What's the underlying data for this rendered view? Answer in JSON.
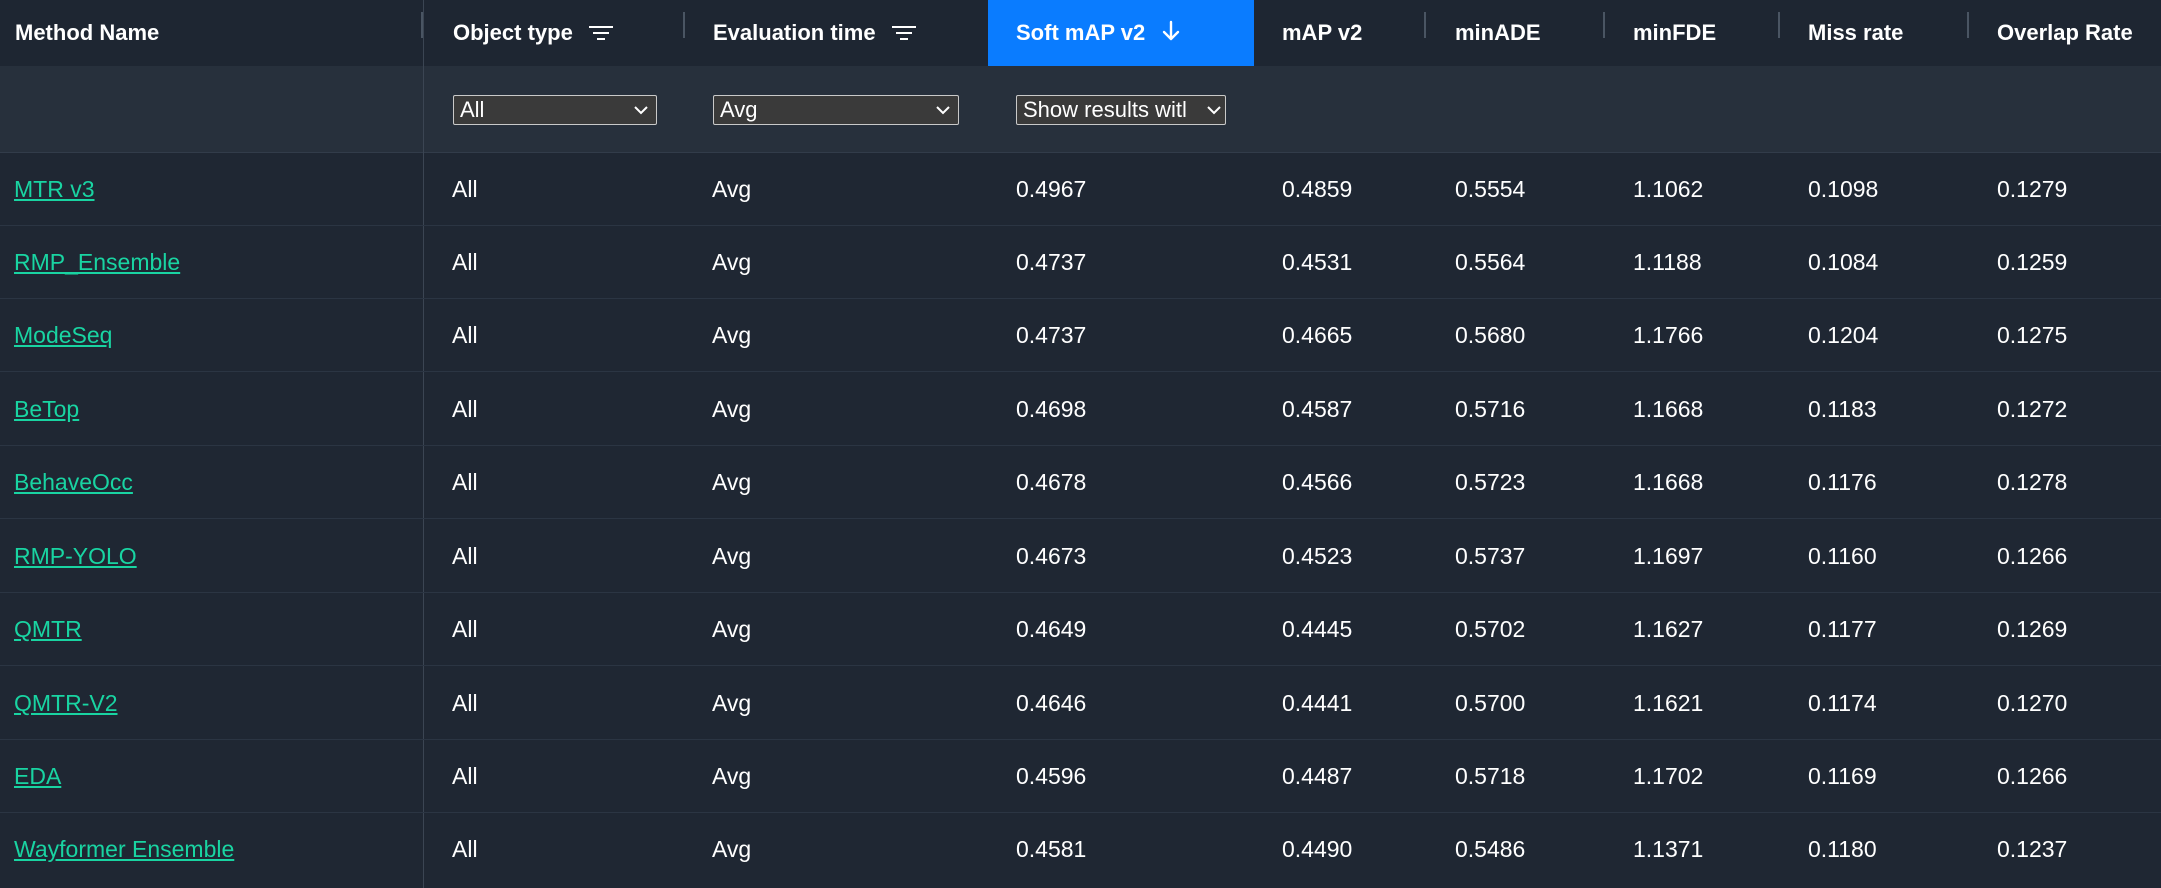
{
  "columns": [
    {
      "label": "Method Name",
      "icon": ""
    },
    {
      "label": "Object type",
      "icon": "filter-icon"
    },
    {
      "label": "Evaluation time",
      "icon": "filter-icon"
    },
    {
      "label": "Soft mAP v2",
      "icon": "arrow-down-icon",
      "sorted": "descending"
    },
    {
      "label": "mAP v2",
      "icon": ""
    },
    {
      "label": "minADE",
      "icon": ""
    },
    {
      "label": "minFDE",
      "icon": ""
    },
    {
      "label": "Miss rate",
      "icon": ""
    },
    {
      "label": "Overlap Rate",
      "icon": ""
    }
  ],
  "filters": {
    "object_type": "All",
    "evaluation_time": "Avg",
    "soft_map": "Show results witl"
  },
  "colors": {
    "accent": "#0a7cff",
    "link": "#19d4a2",
    "background": "#1f2733"
  },
  "rows": [
    {
      "method": "MTR v3",
      "object_type": "All",
      "eval_time": "Avg",
      "soft_map": "0.4967",
      "map": "0.4859",
      "minade": "0.5554",
      "minfde": "1.1062",
      "miss": "0.1098",
      "overlap": "0.1279"
    },
    {
      "method": "RMP_Ensemble",
      "object_type": "All",
      "eval_time": "Avg",
      "soft_map": "0.4737",
      "map": "0.4531",
      "minade": "0.5564",
      "minfde": "1.1188",
      "miss": "0.1084",
      "overlap": "0.1259"
    },
    {
      "method": "ModeSeq",
      "object_type": "All",
      "eval_time": "Avg",
      "soft_map": "0.4737",
      "map": "0.4665",
      "minade": "0.5680",
      "minfde": "1.1766",
      "miss": "0.1204",
      "overlap": "0.1275"
    },
    {
      "method": "BeTop",
      "object_type": "All",
      "eval_time": "Avg",
      "soft_map": "0.4698",
      "map": "0.4587",
      "minade": "0.5716",
      "minfde": "1.1668",
      "miss": "0.1183",
      "overlap": "0.1272"
    },
    {
      "method": "BehaveOcc",
      "object_type": "All",
      "eval_time": "Avg",
      "soft_map": "0.4678",
      "map": "0.4566",
      "minade": "0.5723",
      "minfde": "1.1668",
      "miss": "0.1176",
      "overlap": "0.1278"
    },
    {
      "method": "RMP-YOLO",
      "object_type": "All",
      "eval_time": "Avg",
      "soft_map": "0.4673",
      "map": "0.4523",
      "minade": "0.5737",
      "minfde": "1.1697",
      "miss": "0.1160",
      "overlap": "0.1266"
    },
    {
      "method": "QMTR",
      "object_type": "All",
      "eval_time": "Avg",
      "soft_map": "0.4649",
      "map": "0.4445",
      "minade": "0.5702",
      "minfde": "1.1627",
      "miss": "0.1177",
      "overlap": "0.1269"
    },
    {
      "method": "QMTR-V2",
      "object_type": "All",
      "eval_time": "Avg",
      "soft_map": "0.4646",
      "map": "0.4441",
      "minade": "0.5700",
      "minfde": "1.1621",
      "miss": "0.1174",
      "overlap": "0.1270"
    },
    {
      "method": "EDA",
      "object_type": "All",
      "eval_time": "Avg",
      "soft_map": "0.4596",
      "map": "0.4487",
      "minade": "0.5718",
      "minfde": "1.1702",
      "miss": "0.1169",
      "overlap": "0.1266"
    },
    {
      "method": "Wayformer Ensemble",
      "object_type": "All",
      "eval_time": "Avg",
      "soft_map": "0.4581",
      "map": "0.4490",
      "minade": "0.5486",
      "minfde": "1.1371",
      "miss": "0.1180",
      "overlap": "0.1237"
    }
  ]
}
